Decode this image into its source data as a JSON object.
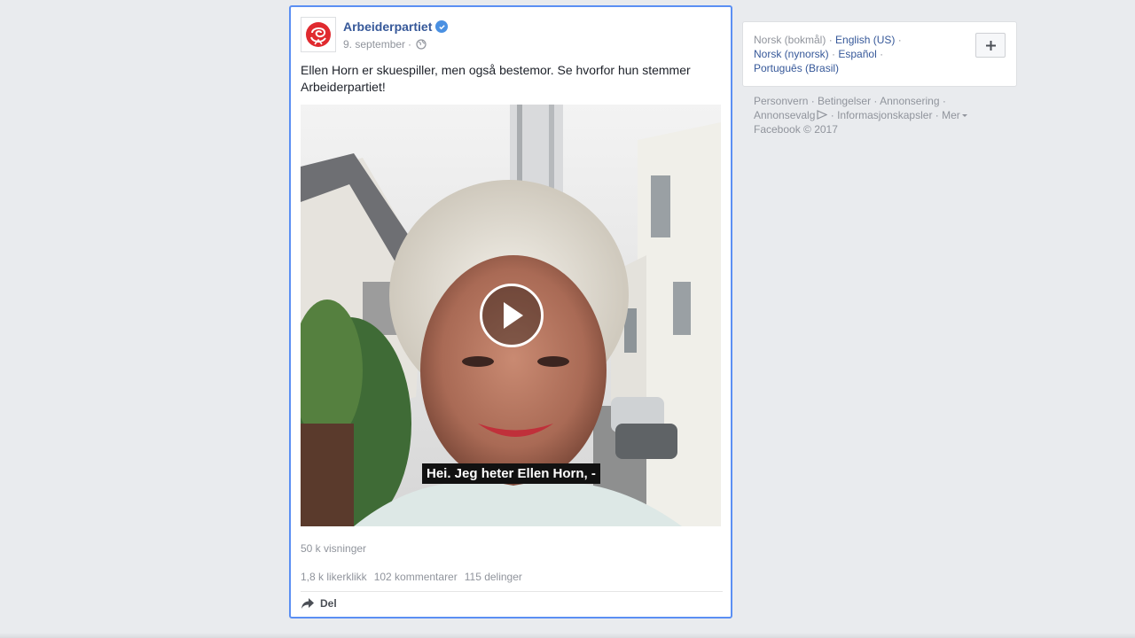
{
  "post": {
    "page_name": "Arbeiderpartiet",
    "verified_icon": "verified-badge-icon",
    "date": "9. september",
    "meta_separator": "·",
    "privacy_icon": "globe-icon",
    "text": "Ellen Horn er skuespiller, men også bestemor. Se hvorfor hun stemmer Arbeiderpartiet!",
    "video": {
      "subtitle": "Hei. Jeg heter Ellen Horn, -",
      "play_icon": "play-icon"
    },
    "views": "50 k visninger",
    "likes": "1,8 k likerklikk",
    "comments": "102 kommentarer",
    "shares": "115 delinger",
    "share_label": "Del",
    "colors": {
      "link": "#365899",
      "highlight_border": "#5b8ff3",
      "brand_red": "#e02a2f"
    }
  },
  "sidebar": {
    "languages": {
      "current": "Norsk (bokmål)",
      "links": [
        "English (US)",
        "Norsk (nynorsk)",
        "Español",
        "Português (Brasil)"
      ],
      "separator": "·",
      "add_icon": "plus-icon"
    },
    "footer": {
      "links": [
        "Personvern",
        "Betingelser",
        "Annonsering",
        "Annonsevalg",
        "Informasjonskapsler",
        "Mer"
      ],
      "copyright": "Facebook © 2017"
    }
  }
}
